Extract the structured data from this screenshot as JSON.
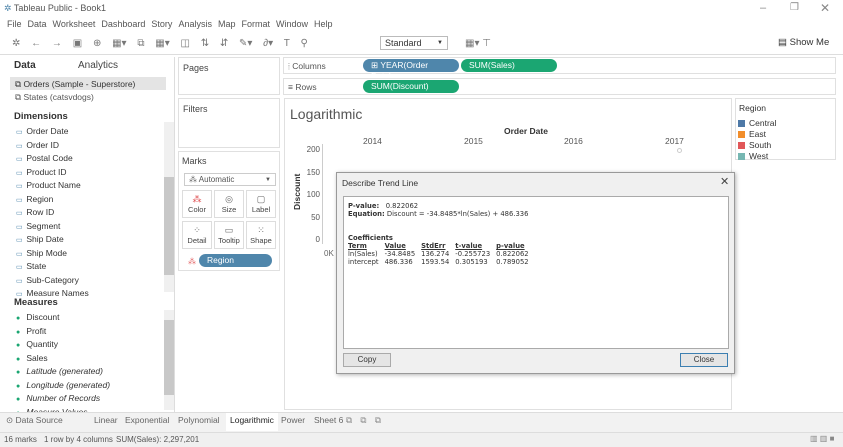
{
  "window": {
    "title": "Tableau Public - Book1"
  },
  "menu": [
    "File",
    "Data",
    "Worksheet",
    "Dashboard",
    "Story",
    "Analysis",
    "Map",
    "Format",
    "Window",
    "Help"
  ],
  "toolbar": {
    "fit": "Standard",
    "show_me": "Show Me"
  },
  "data_pane": {
    "tabs": [
      "Data",
      "Analytics"
    ],
    "sources": [
      "Orders (Sample - Superstore)",
      "States (catsvdogs)"
    ],
    "dimensions_label": "Dimensions",
    "dimensions": [
      "Order Date",
      "Order ID",
      "Postal Code",
      "Product ID",
      "Product Name",
      "Region",
      "Row ID",
      "Segment",
      "Ship Date",
      "Ship Mode",
      "State",
      "Sub-Category",
      "Measure Names"
    ],
    "measures_label": "Measures",
    "measures": [
      "Discount",
      "Profit",
      "Quantity",
      "Sales",
      "Latitude (generated)",
      "Longitude (generated)",
      "Number of Records",
      "Measure Values"
    ]
  },
  "cards": {
    "pages": "Pages",
    "filters": "Filters",
    "marks": "Marks",
    "mark_type": "Automatic",
    "buttons": [
      "Color",
      "Size",
      "Label",
      "Detail",
      "Tooltip",
      "Shape"
    ],
    "region_pill": "Region"
  },
  "shelves": {
    "columns": "Columns",
    "rows": "Rows",
    "column_pills": [
      "YEAR(Order Date)",
      "SUM(Sales)"
    ],
    "row_pills": [
      "SUM(Discount)"
    ]
  },
  "view": {
    "title": "Logarithmic",
    "header": "Order Date",
    "years": [
      "2014",
      "2015",
      "2016",
      "2017"
    ],
    "y_label": "Discount",
    "y_ticks": [
      "200",
      "150",
      "100",
      "50",
      "0"
    ],
    "x_tick": "0K"
  },
  "legend": {
    "title": "Region",
    "items": [
      {
        "label": "Central",
        "color": "#4e79a7"
      },
      {
        "label": "East",
        "color": "#f28e2b"
      },
      {
        "label": "South",
        "color": "#e15759"
      },
      {
        "label": "West",
        "color": "#76b7b2"
      }
    ]
  },
  "dialog": {
    "title": "Describe Trend Line",
    "p_label": "P-value:",
    "p_value": "0.822062",
    "eq_label": "Equation:",
    "equation": "Discount = -34.8485*ln(Sales) + 486.336",
    "coef_label": "Coefficients",
    "headers": [
      "Term",
      "Value",
      "StdErr",
      "t-value",
      "p-value"
    ],
    "rows": [
      [
        "ln(Sales)",
        "-34.8485",
        "136.274",
        "-0.255723",
        "0.822062"
      ],
      [
        "intercept",
        "486.336",
        "1593.54",
        "0.305193",
        "0.789052"
      ]
    ],
    "copy": "Copy",
    "close": "Close"
  },
  "tabs": {
    "data_source": "Data Source",
    "sheets": [
      "Linear",
      "Exponential",
      "Polynomial",
      "Logarithmic",
      "Power",
      "Sheet 6"
    ],
    "active": "Logarithmic"
  },
  "status": {
    "marks": "16 marks",
    "dims": "1 row by 4 columns",
    "sum": "SUM(Sales): 2,297,201"
  }
}
